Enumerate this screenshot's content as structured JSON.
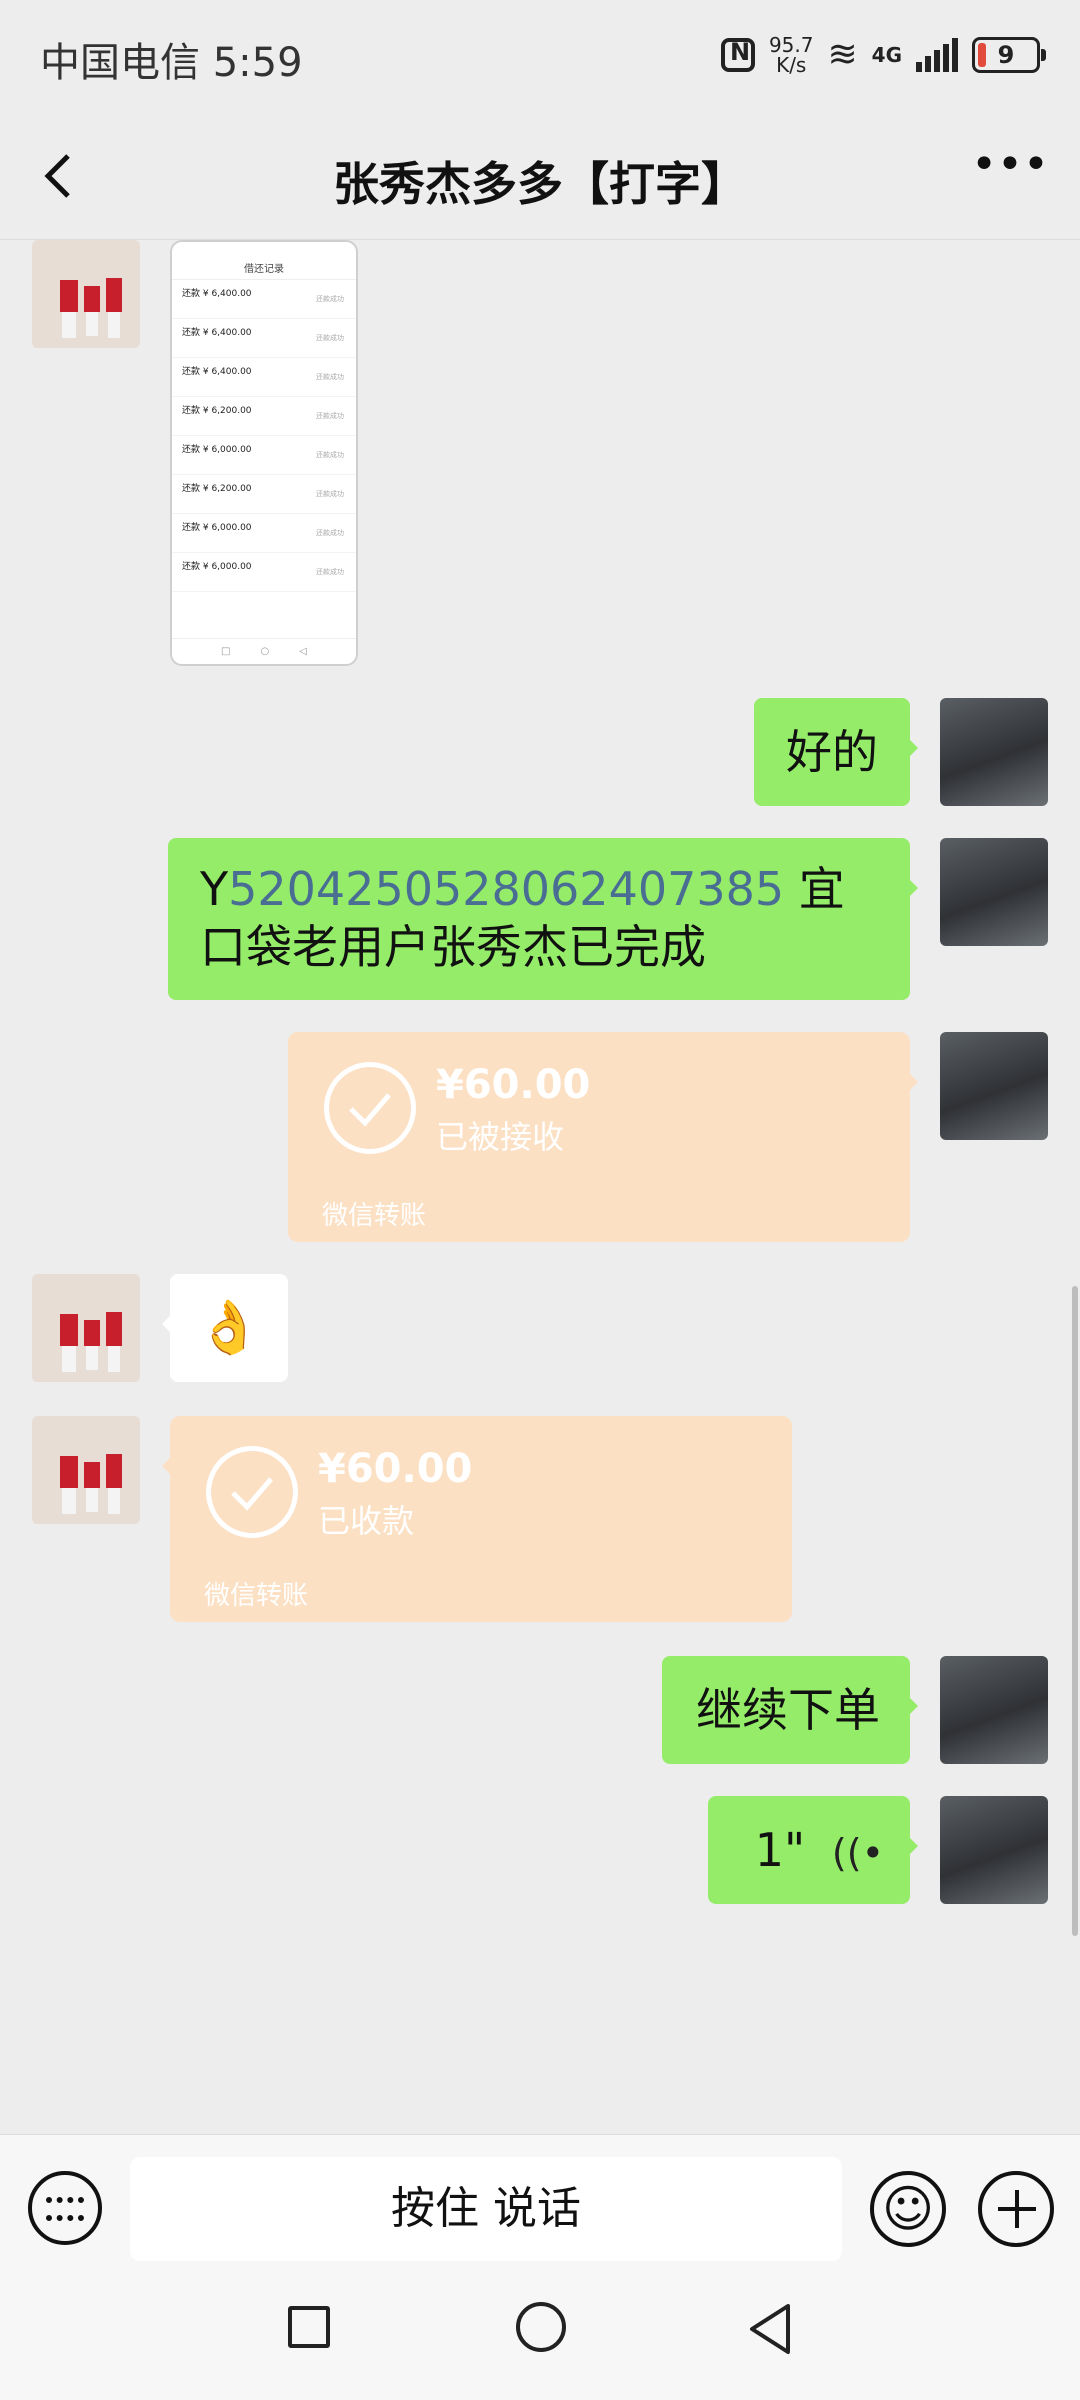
{
  "status_bar": {
    "carrier_time": "中国电信 5:59",
    "speed_value": "95.7",
    "speed_unit": "K/s",
    "network": "4G",
    "battery": "9"
  },
  "header": {
    "title": "张秀杰多多【打字】"
  },
  "screenshot_thumb": {
    "title": "借还记录",
    "rows": [
      {
        "value": "还款 ¥ 6,400.00",
        "status": "还款成功"
      },
      {
        "value": "还款 ¥ 6,400.00",
        "status": "还款成功"
      },
      {
        "value": "还款 ¥ 6,400.00",
        "status": "还款成功"
      },
      {
        "value": "还款 ¥ 6,200.00",
        "status": "还款成功"
      },
      {
        "value": "还款 ¥ 6,000.00",
        "status": "还款成功"
      },
      {
        "value": "还款 ¥ 6,200.00",
        "status": "还款成功"
      },
      {
        "value": "还款 ¥ 6,000.00",
        "status": "还款成功"
      },
      {
        "value": "还款 ¥ 6,000.00",
        "status": "还款成功"
      }
    ]
  },
  "messages": {
    "m1": "好的",
    "m2_prefix": "Y",
    "m2_code": "520425052806240738​5",
    "m2_rest": " 宜口袋老用户张秀杰已完成",
    "transfer1": {
      "amount": "¥60.00",
      "status": "已被接收",
      "footer": "微信转账"
    },
    "emoji": "👌",
    "transfer2": {
      "amount": "¥60.00",
      "status": "已收款",
      "footer": "微信转账"
    },
    "m3": "继续下单",
    "voice_duration": "1\""
  },
  "input": {
    "talk_label": "按住 说话"
  }
}
